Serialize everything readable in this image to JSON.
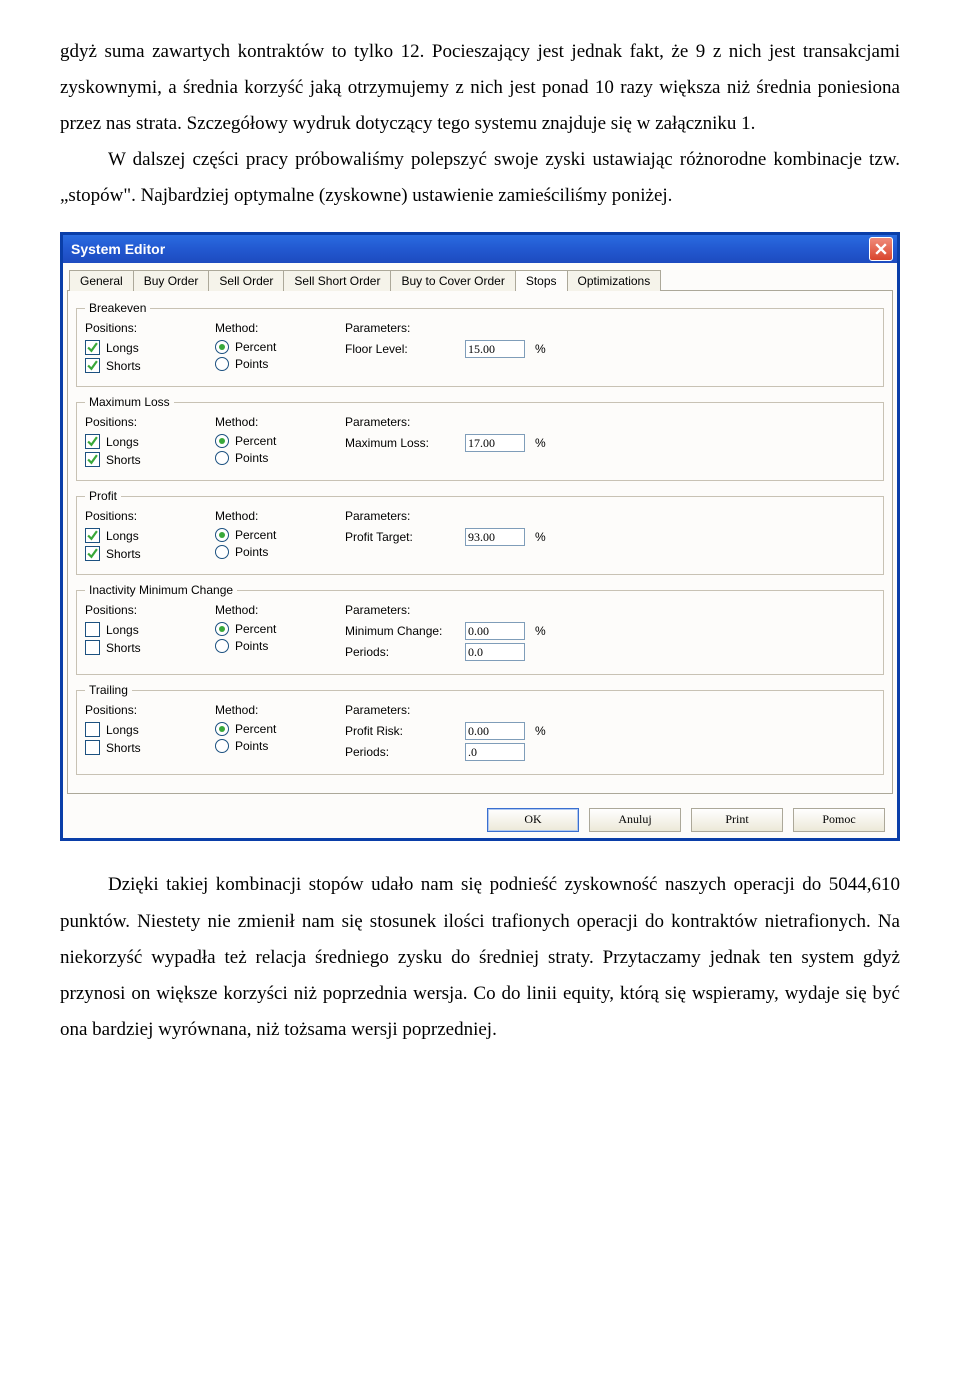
{
  "text": {
    "para1": "gdyż suma zawartych kontraktów to tylko 12. Pocieszający jest jednak fakt, że 9 z nich jest transakcjami zyskownymi, a średnia korzyść jaką otrzymujemy z nich jest ponad 10 razy większa niż średnia poniesiona przez nas strata. Szczegółowy wydruk dotyczący tego systemu znajduje się w załączniku 1.",
    "para2": "W dalszej części pracy próbowaliśmy polepszyć swoje zyski ustawiając różnorodne kombinacje tzw. „stopów\". Najbardziej optymalne (zyskowne) ustawienie zamieściliśmy poniżej.",
    "para3": "Dzięki takiej kombinacji stopów udało nam się podnieść zyskowność naszych operacji do 5044,610 punktów. Niestety nie zmienił nam się stosunek ilości trafionych operacji do kontraktów nietrafionych. Na niekorzyść wypadła też relacja średniego zysku do średniej straty. Przytaczamy jednak ten system gdyż przynosi on większe korzyści niż poprzednia wersja. Co do linii equity, którą się wspieramy, wydaje się być ona bardziej wyrównana, niż tożsama wersji poprzedniej."
  },
  "win": {
    "title": "System Editor",
    "tabs": [
      "General",
      "Buy Order",
      "Sell Order",
      "Sell Short Order",
      "Buy to Cover Order",
      "Stops",
      "Optimizations"
    ],
    "active_tab_index": 5,
    "headers": {
      "positions": "Positions:",
      "method": "Method:",
      "parameters": "Parameters:"
    },
    "labels": {
      "longs": "Longs",
      "shorts": "Shorts",
      "percent": "Percent",
      "points": "Points",
      "pct": "%"
    },
    "groups": [
      {
        "legend": "Breakeven",
        "longs": true,
        "shorts": true,
        "method": "percent",
        "params": [
          {
            "label": "Floor Level:",
            "value": "15.00",
            "pct": true
          }
        ]
      },
      {
        "legend": "Maximum Loss",
        "longs": true,
        "shorts": true,
        "method": "percent",
        "params": [
          {
            "label": "Maximum Loss:",
            "value": "17.00",
            "pct": true
          }
        ]
      },
      {
        "legend": "Profit",
        "longs": true,
        "shorts": true,
        "method": "percent",
        "params": [
          {
            "label": "Profit Target:",
            "value": "93.00",
            "pct": true
          }
        ]
      },
      {
        "legend": "Inactivity Minimum Change",
        "longs": false,
        "shorts": false,
        "method": "percent",
        "params": [
          {
            "label": "Minimum Change:",
            "value": "0.00",
            "pct": true
          },
          {
            "label": "Periods:",
            "value": "0.0",
            "pct": false
          }
        ]
      },
      {
        "legend": "Trailing",
        "longs": false,
        "shorts": false,
        "method": "percent",
        "params": [
          {
            "label": "Profit Risk:",
            "value": "0.00",
            "pct": true
          },
          {
            "label": "Periods:",
            "value": ".0",
            "pct": false
          }
        ]
      }
    ],
    "buttons": {
      "ok": "OK",
      "cancel": "Anuluj",
      "print": "Print",
      "help": "Pomoc"
    }
  }
}
